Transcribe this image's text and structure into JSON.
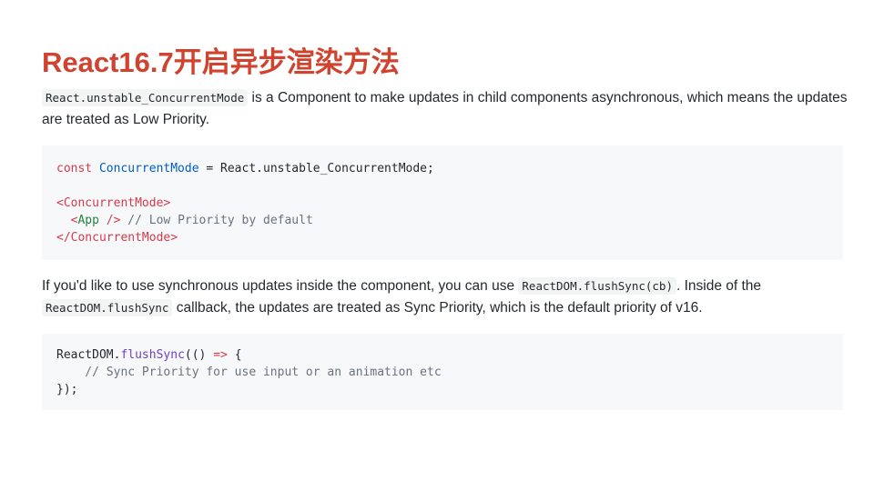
{
  "title": "React16.7开启异步渲染方法",
  "para1": {
    "code": "React.unstable_ConcurrentMode",
    "text": " is a Component to make updates in child components asynchronous, which means the updates are treated as Low Priority."
  },
  "code1": {
    "l1_const": "const",
    "l1_ident": "ConcurrentMode",
    "l1_rest": " = React.unstable_ConcurrentMode;",
    "l3_open": "<ConcurrentMode>",
    "l4_indent": "  ",
    "l4_open": "<",
    "l4_tag": "App",
    "l4_close": " />",
    "l4_comment": " // Low Priority by default",
    "l5_close": "</ConcurrentMode>"
  },
  "para2": {
    "t1": "If you'd like to use synchronous updates inside the component, you can use ",
    "code1": "ReactDOM.flushSync(cb)",
    "t2": ". Inside of the ",
    "code2": "ReactDOM.flushSync",
    "t3": " callback, the updates are treated as Sync Priority, which is the default priority of v16."
  },
  "code2": {
    "l1_obj": "ReactDOM.",
    "l1_fn": "flushSync",
    "l1_args": "(() ",
    "l1_arrow": "=>",
    "l1_brace": " {",
    "l2_comment": "    // Sync Priority for use input or an animation etc",
    "l3": "});"
  }
}
